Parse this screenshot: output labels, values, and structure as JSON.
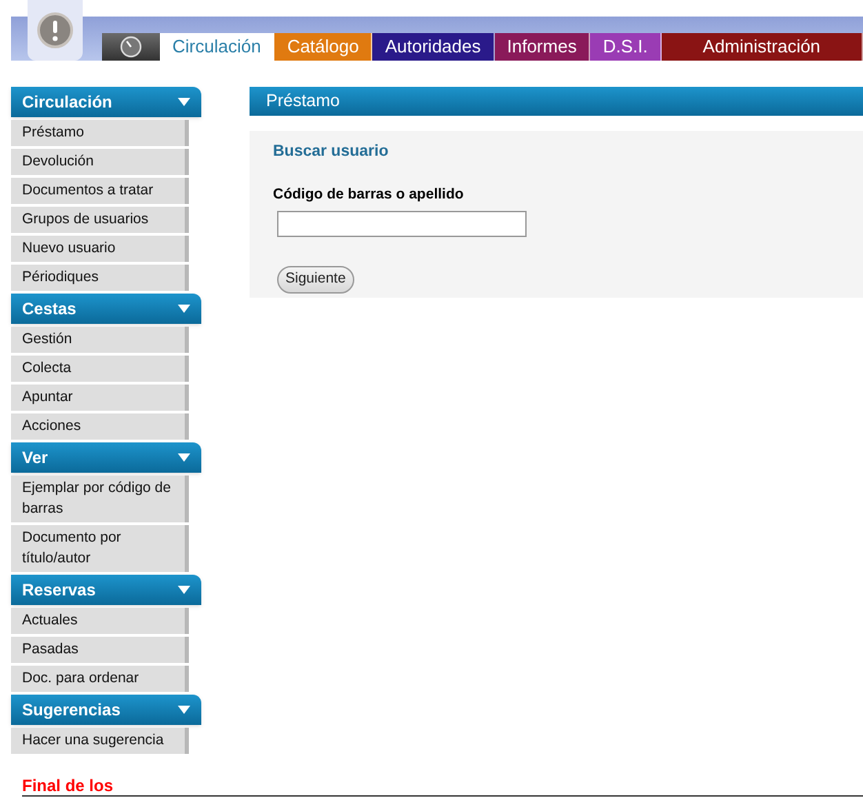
{
  "tabs": [
    {
      "kind": "icon",
      "selected": false,
      "color": "#6b6b6b"
    },
    {
      "kind": "text",
      "label": "Circulación",
      "selected": true,
      "color": "#ffffff"
    },
    {
      "kind": "text",
      "label": "Catálogo",
      "selected": false,
      "color": "#e07a10"
    },
    {
      "kind": "text",
      "label": "Autoridades",
      "selected": false,
      "color": "#2a1a8a"
    },
    {
      "kind": "text",
      "label": "Informes",
      "selected": false,
      "color": "#8a1a5a"
    },
    {
      "kind": "text",
      "label": "D.S.I.",
      "selected": false,
      "color": "#9a3cb4"
    },
    {
      "kind": "text",
      "label": "Administración",
      "selected": false,
      "color": "#8a1414"
    }
  ],
  "sidebar": [
    {
      "title": "Circulación",
      "expanded": true,
      "items": [
        "Préstamo",
        "Devolución",
        "Documentos a tratar",
        "Grupos de usuarios",
        "Nuevo usuario",
        "Périodiques"
      ]
    },
    {
      "title": "Cestas",
      "expanded": true,
      "items": [
        "Gestión",
        "Colecta",
        "Apuntar",
        "Acciones"
      ]
    },
    {
      "title": "Ver",
      "expanded": true,
      "items": [
        "Ejemplar por código de barras",
        "Documento por título/autor"
      ]
    },
    {
      "title": "Reservas",
      "expanded": true,
      "items": [
        "Actuales",
        "Pasadas",
        "Doc. para ordenar"
      ]
    },
    {
      "title": "Sugerencias",
      "expanded": true,
      "items": [
        "Hacer una sugerencia"
      ]
    }
  ],
  "panel": {
    "title": "Préstamo",
    "subtitle": "Buscar usuario",
    "field_label": "Código de barras o apellido",
    "button": "Siguiente"
  },
  "footer_text": "Final de los"
}
